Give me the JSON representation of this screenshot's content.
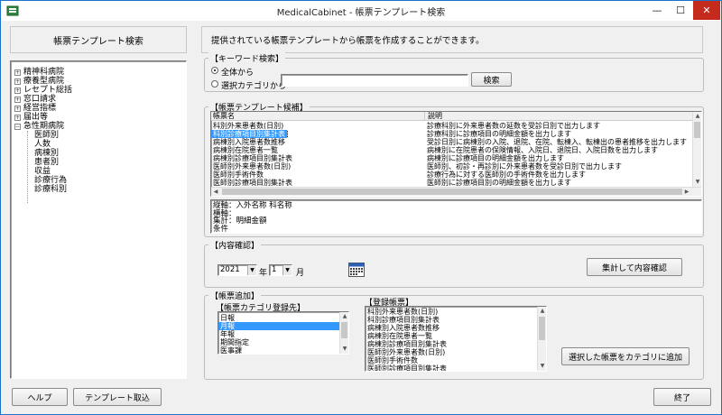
{
  "window": {
    "title": "MedicalCabinet - 帳票テンプレート検索",
    "min_glyph": "—",
    "max_glyph": "☐",
    "close_glyph": "✕"
  },
  "left": {
    "header": "帳票テンプレート検索",
    "tree": [
      {
        "label": "精神科病院",
        "expanded": false
      },
      {
        "label": "療養型病院",
        "expanded": false
      },
      {
        "label": "レセプト総括",
        "expanded": false
      },
      {
        "label": "窓口請求",
        "expanded": false
      },
      {
        "label": "経営指標",
        "expanded": false
      },
      {
        "label": "届出等",
        "expanded": false
      },
      {
        "label": "急性期病院",
        "expanded": true
      }
    ],
    "children": [
      "医師別",
      "人数",
      "病棟別",
      "患者別",
      "収益",
      "診療行為",
      "診療科別"
    ],
    "expand_glyph": "+",
    "collapse_glyph": "−"
  },
  "info_text": "提供されている帳票テンプレートから帳票を作成することができます。",
  "keyword": {
    "group_label": "【キーワード検索】",
    "radio_all": "全体から",
    "radio_category": "選択カテゴリから",
    "input_value": "",
    "search_button": "検索"
  },
  "candidates": {
    "group_label": "【帳票テンプレート候補】",
    "col_name": "帳票名",
    "col_desc": "説明",
    "rows": [
      {
        "name": "科別外来患者数(日別)",
        "desc": "診療科別に外来患者数の延数を受診日別で出力します"
      },
      {
        "name": "科別診療項目別集計表",
        "desc": "診療科別に診療項目の明細金額を出力します"
      },
      {
        "name": "病棟別入院患者数推移",
        "desc": "受診日別に病棟別の入院、退院、在院、転棟入、転棟出の患者推移を出力します"
      },
      {
        "name": "病棟別在院患者一覧",
        "desc": "病棟別に在院患者の保険情報、入院日、退院日、入院日数を出力します"
      },
      {
        "name": "病棟別診療項目別集計表",
        "desc": "病棟別に診療項目の明細金額を出力します"
      },
      {
        "name": "医師別外来患者数(日別)",
        "desc": "医師別、初診・再診別に外来患者数を受診日別で出力します"
      },
      {
        "name": "医師別手術件数",
        "desc": "診療行為に対する医師別の手術件数を出力します"
      },
      {
        "name": "医師別診療項目別集計表",
        "desc": "医師別に診療項目別の明細金額を出力します"
      }
    ],
    "selected_index": 1,
    "detail": [
      "縦軸：入外名称 科名称",
      "横軸：",
      "集計：明細金額",
      "条件"
    ]
  },
  "confirm": {
    "group_label": "【内容確認】",
    "year": "2021",
    "year_unit": "年",
    "month": "1",
    "month_unit": "月",
    "button": "集計して内容確認"
  },
  "add": {
    "group_label": "【帳票追加】",
    "category_label": "【帳票カテゴリ登録先】",
    "categories": [
      "日報",
      "月報",
      "年報",
      "期間指定",
      "医事課"
    ],
    "selected_category": 1,
    "registered_label": "【登録帳票】",
    "registered": [
      "科別外来患者数(日別)",
      "科別診療項目別集計表",
      "病棟別入院患者数推移",
      "病棟別在院患者一覧",
      "病棟別診療項目別集計表",
      "医師別外来患者数(日別)",
      "医師別手術件数",
      "医師別診療項目別集計表"
    ],
    "button": "選択した帳票をカテゴリに追加"
  },
  "footer": {
    "help": "ヘルプ",
    "import": "テンプレート取込",
    "exit": "終了"
  }
}
